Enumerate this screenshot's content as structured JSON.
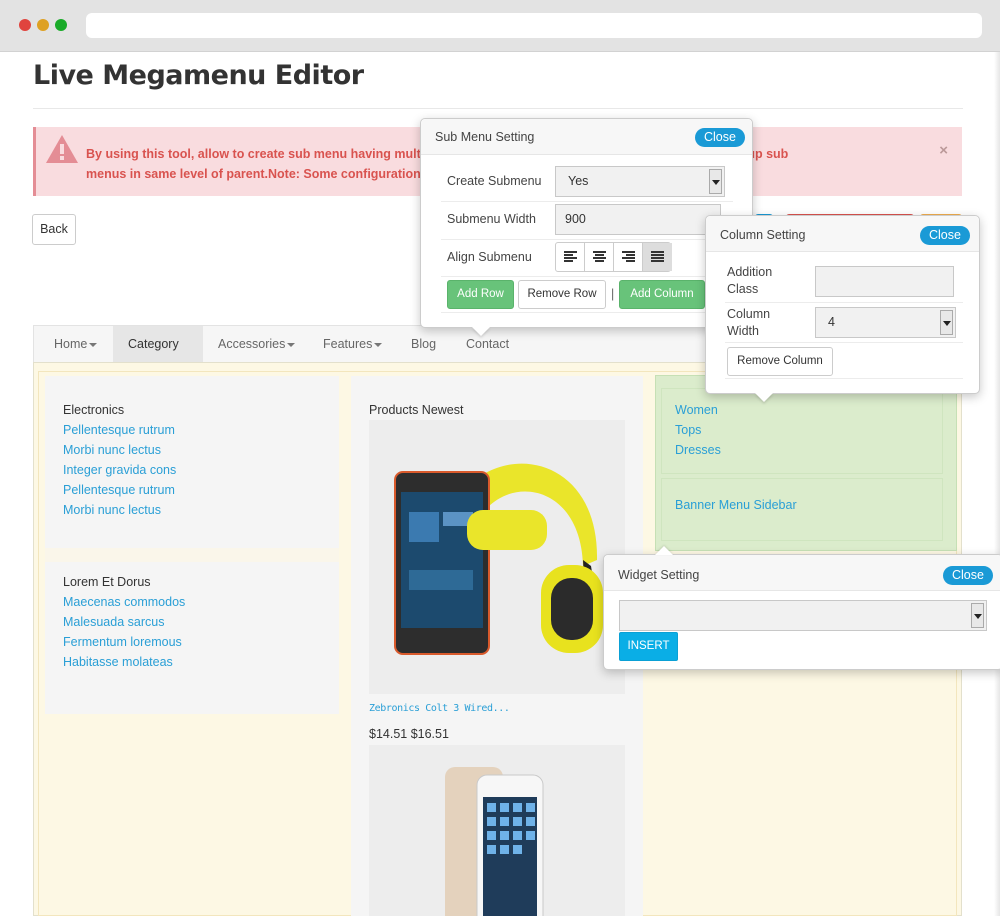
{
  "page": {
    "title": "Live Megamenu Editor"
  },
  "alert": {
    "line1": "By using this tool, allow to create sub menu having mult",
    "line1_end": "inside columns or group sub",
    "line2": "menus in same level of parent.Note: Some configuration",
    "close": "×"
  },
  "toolbar": {
    "back_label": "Back"
  },
  "nav": {
    "items": [
      {
        "label": "Home",
        "dropdown": true
      },
      {
        "label": "Category",
        "dropdown": true,
        "active": true
      },
      {
        "label": "Accessories",
        "dropdown": true
      },
      {
        "label": "Features",
        "dropdown": true
      },
      {
        "label": "Blog",
        "dropdown": false
      },
      {
        "label": "Contact",
        "dropdown": false
      }
    ]
  },
  "menu": {
    "col1": {
      "group1": {
        "heading": "Electronics",
        "links": [
          "Pellentesque rutrum",
          "Morbi nunc lectus",
          "Integer gravida cons",
          "Pellentesque rutrum",
          "Morbi nunc lectus"
        ]
      },
      "group2": {
        "heading": "Lorem Et Dorus",
        "links": [
          "Maecenas commodos",
          "Malesuada sarcus",
          "Fermentum loremous",
          "Habitasse molateas"
        ]
      }
    },
    "col2": {
      "heading": "Products Newest",
      "product1": {
        "name": "Zebronics Colt 3 Wired...",
        "price": "$14.51 $16.51"
      }
    },
    "col3": {
      "links": [
        "Women",
        "Tops",
        "Dresses"
      ],
      "banner": "Banner Menu Sidebar"
    }
  },
  "submenu_panel": {
    "title": "Sub Menu Setting",
    "close": "Close",
    "create_label": "Create Submenu",
    "create_value": "Yes",
    "width_label": "Submenu Width",
    "width_value": "900",
    "align_label": "Align Submenu",
    "add_row": "Add Row",
    "remove_row": "Remove Row",
    "separator": "|",
    "add_column": "Add Column"
  },
  "column_panel": {
    "title": "Column Setting",
    "close": "Close",
    "class_label_1": "Addition",
    "class_label_2": "Class",
    "class_value": "",
    "width_label_1": "Column",
    "width_label_2": "Width",
    "width_value": "4",
    "remove": "Remove Column"
  },
  "widget_panel": {
    "title": "Widget Setting",
    "close": "Close",
    "select_value": "",
    "insert": "INSERT"
  },
  "colors": {
    "accent": "#1a9ad6",
    "link": "#2a9fd6",
    "green": "#68c37a",
    "alert_bg": "#f9dcdf",
    "alert_text": "#d9534f"
  }
}
